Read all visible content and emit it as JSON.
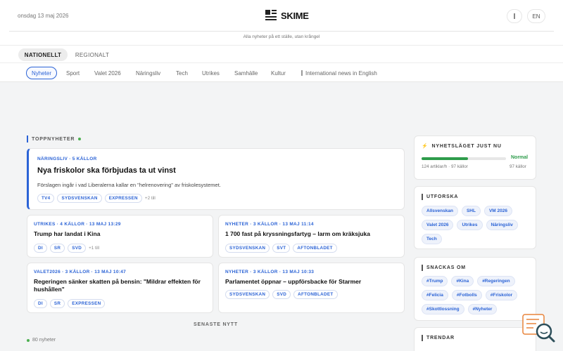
{
  "header": {
    "date": "onsdag 13 maj 2026",
    "brand": "SKIME",
    "lang_label": "EN",
    "tagline": "Alla nyheter på ett ställe, utan krångel"
  },
  "region_tabs": [
    "NATIONELLT",
    "REGIONALT"
  ],
  "categories": [
    "Nyheter",
    "Sport",
    "Valet 2026",
    "Näringsliv",
    "Tech",
    "Utrikes",
    "Samhälle",
    "Kultur",
    "International news in English"
  ],
  "top_news": {
    "title": "TOPPNYHETER",
    "featured": {
      "kicker": "NÄRINGSLIV · 5 KÄLLOR",
      "headline": "Nya friskolor ska förbjudas ta ut vinst",
      "dek": "Förslagen ingår i vad Liberalerna kallar en \"helrenovering\" av friskolesystemet.",
      "sources": [
        "TV4",
        "SYDSVENSKAN",
        "EXPRESSEN"
      ],
      "more": "+2 till"
    },
    "cards": [
      {
        "kicker": "UTRIKES · 4 KÄLLOR · 13 MAJ 13:29",
        "headline": "Trump har landat i Kina",
        "sources": [
          "DI",
          "SR",
          "SVD"
        ],
        "more": "+1 till"
      },
      {
        "kicker": "NYHETER · 3 KÄLLOR · 13 MAJ 11:14",
        "headline": "1 700 fast på kryssningsfartyg – larm om kräksjuka",
        "sources": [
          "SYDSVENSKAN",
          "SVT",
          "AFTONBLADET"
        ],
        "more": ""
      },
      {
        "kicker": "VALET2026 · 3 KÄLLOR · 13 MAJ 10:47",
        "headline": "Regeringen sänker skatten på bensin: \"Mildrar effekten för hushållen\"",
        "sources": [
          "DI",
          "SR",
          "EXPRESSEN"
        ],
        "more": ""
      },
      {
        "kicker": "NYHETER · 3 KÄLLOR · 13 MAJ 10:33",
        "headline": "Parlamentet öppnar – uppförsbacke för Starmer",
        "sources": [
          "SYDSVENSKAN",
          "SVD",
          "AFTONBLADET"
        ],
        "more": ""
      }
    ]
  },
  "latest": {
    "title": "SENASTE NYTT",
    "count": "80 nyheter"
  },
  "sidebar": {
    "status": {
      "title": "NYHETSLÄGET JUST NU",
      "level_label": "Normal",
      "level_fraction": 0.55,
      "rate": "124 artiklar/h",
      "sources": "97 källor"
    },
    "explore": {
      "title": "UTFORSKA",
      "chips": [
        "Allsvenskan",
        "SHL",
        "VM 2026",
        "Valet 2026",
        "Utrikes",
        "Näringsliv",
        "Tech"
      ]
    },
    "trending": {
      "title": "SNACKAS OM",
      "chips": [
        "#Trump",
        "#Kina",
        "#Regeringen",
        "#Felicia",
        "#Fotbolls",
        "#Friskolor",
        "#Skottlossning",
        "#Nyheter"
      ]
    },
    "trends": {
      "title": "TRENDAR"
    }
  },
  "colors": {
    "accent": "#2b63d6",
    "status_green": "#2e9c4b",
    "live_dot": "#4caf50"
  },
  "icons": {
    "fab": "feedback-search-icon",
    "theme": "theme-toggle-icon"
  }
}
